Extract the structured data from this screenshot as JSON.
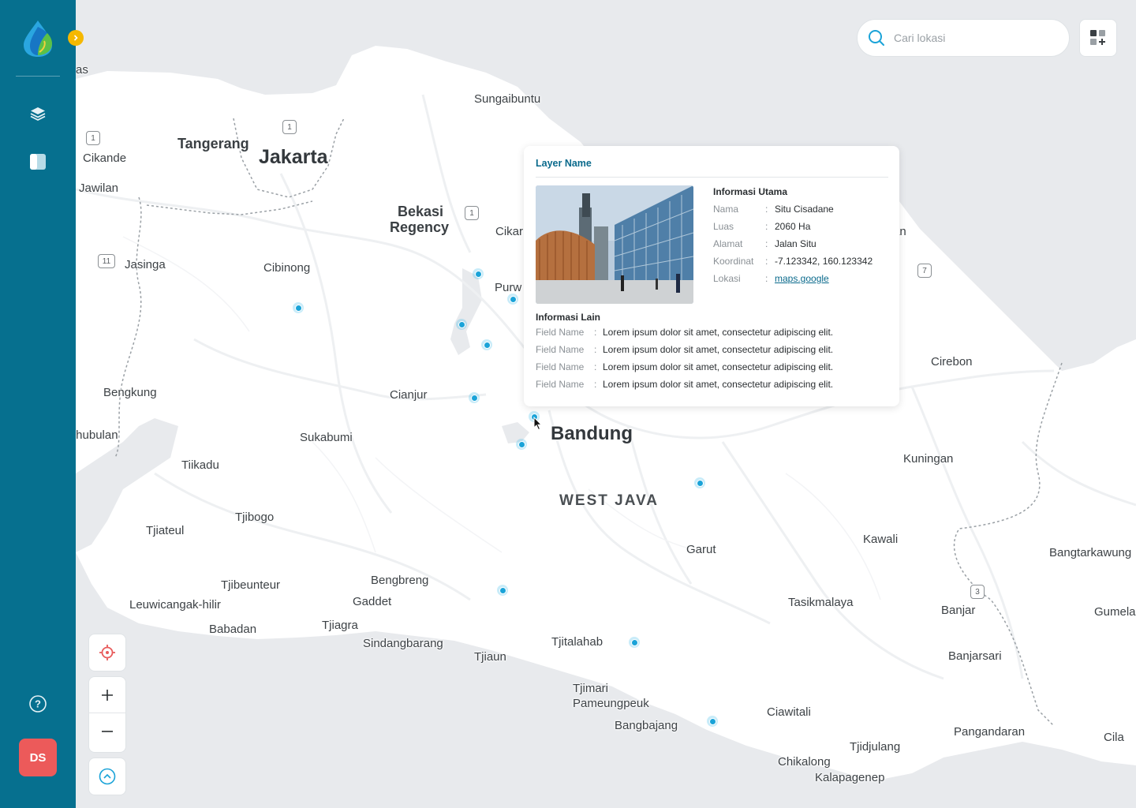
{
  "sidebar": {
    "avatar_initials": "DS",
    "items": [
      {
        "icon": "layers-icon"
      },
      {
        "icon": "panel-icon"
      }
    ],
    "help_icon": "help-icon",
    "expand_icon": "chevron-right-icon"
  },
  "search": {
    "placeholder": "Cari lokasi"
  },
  "popup": {
    "layer_name": "Layer Name",
    "main_title": "Informasi Utama",
    "fields": [
      {
        "label": "Nama",
        "value": "Situ Cisadane"
      },
      {
        "label": "Luas",
        "value": "2060 Ha"
      },
      {
        "label": "Alamat",
        "value": "Jalan Situ"
      },
      {
        "label": "Koordinat",
        "value": "-7.123342, 160.123342"
      },
      {
        "label": "Lokasi",
        "value": "maps.google"
      }
    ],
    "other_title": "Informasi Lain",
    "other_fields": [
      {
        "label": "Field Name",
        "value": "Lorem ipsum dolor sit amet, consectetur adipiscing elit."
      },
      {
        "label": "Field Name",
        "value": "Lorem ipsum dolor sit amet, consectetur adipiscing elit."
      },
      {
        "label": "Field Name",
        "value": "Lorem ipsum dolor sit amet, consectetur adipiscing elit."
      },
      {
        "label": "Field Name",
        "value": "Lorem ipsum dolor sit amet, consectetur adipiscing elit."
      }
    ]
  },
  "map": {
    "places": {
      "sungaibuntu": "Sungaibuntu",
      "tangerang": "Tangerang",
      "jakarta": "Jakarta",
      "cikande": "Cikande",
      "jawilan": "Jawilan",
      "bekasi": "Bekasi",
      "regency": "Regency",
      "cikar": "Cikar",
      "jasinga": "Jasinga",
      "cibinong": "Cibinong",
      "purw": "Purw",
      "bengkung": "Bengkung",
      "cianjur": "Cianjur",
      "hubulan": "ıhubulan",
      "sukabumi": "Sukabumi",
      "bandung": "Bandung",
      "tiikadu": "Tiikadu",
      "westjava": "WEST JAVA",
      "tjibogo": "Tjibogo",
      "tjiateul": "Tjiateul",
      "garut": "Garut",
      "kuningan": "Kuningan",
      "kawali": "Kawali",
      "bangtarkawung": "Bangtarkawung",
      "cirebon": "Cirebon",
      "an": "an",
      "tjibeunteur": "Tjibeunteur",
      "bengbreng": "Bengbreng",
      "leuwicangak": "Leuwicangak-hilir",
      "gaddet": "Gaddet",
      "babadan": "Babadan",
      "tjiagra": "Tjiagra",
      "sindangbarang": "Sindangbarang",
      "tjiaun": "Tjiaun",
      "tjitalahab": "Tjitalahab",
      "tasikmalaya": "Tasikmalaya",
      "banjar": "Banjar",
      "gumela": "Gumela",
      "banjarsari": "Banjarsari",
      "tjimari": "Tjimari",
      "pameungpeuk": "Pameungpeuk",
      "bangbajang": "Bangbajang",
      "ciawitali": "Ciawitali",
      "pangandaran": "Pangandaran",
      "cila": "Cila",
      "tjidjulang": "Tjidjulang",
      "chikalong": "Chikalong",
      "kalapagenep": "Kalapagenep",
      "as": "as"
    },
    "shields": [
      "1",
      "1",
      "1",
      "11",
      "7",
      "3"
    ]
  },
  "colors": {
    "sidebar": "#06708f",
    "accent": "#0a6a8c",
    "marker": "#1aa3d8",
    "avatar": "#ec5a5a",
    "expand": "#f5b800"
  }
}
